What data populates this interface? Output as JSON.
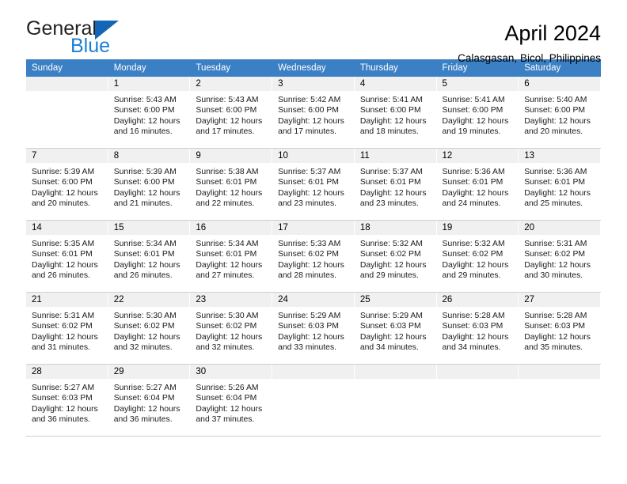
{
  "brand": {
    "name_part1": "General",
    "name_part2": "Blue",
    "triangle_icon": "blue-triangle-logo-mark",
    "colors": {
      "dark": "#231f20",
      "blue": "#1b7fd4",
      "triangle": "#1266b5"
    }
  },
  "header": {
    "title": "April 2024",
    "subtitle": "Calasgasan, Bicol, Philippines"
  },
  "calendar": {
    "accent_color": "#3b7fc4",
    "daynum_bg": "#f0f0f0",
    "weekday_headers": [
      "Sunday",
      "Monday",
      "Tuesday",
      "Wednesday",
      "Thursday",
      "Friday",
      "Saturday"
    ],
    "weeks": [
      [
        {
          "day": "",
          "sunrise": "",
          "sunset": "",
          "daylight_line1": "",
          "daylight_line2": ""
        },
        {
          "day": "1",
          "sunrise": "Sunrise: 5:43 AM",
          "sunset": "Sunset: 6:00 PM",
          "daylight_line1": "Daylight: 12 hours",
          "daylight_line2": "and 16 minutes."
        },
        {
          "day": "2",
          "sunrise": "Sunrise: 5:43 AM",
          "sunset": "Sunset: 6:00 PM",
          "daylight_line1": "Daylight: 12 hours",
          "daylight_line2": "and 17 minutes."
        },
        {
          "day": "3",
          "sunrise": "Sunrise: 5:42 AM",
          "sunset": "Sunset: 6:00 PM",
          "daylight_line1": "Daylight: 12 hours",
          "daylight_line2": "and 17 minutes."
        },
        {
          "day": "4",
          "sunrise": "Sunrise: 5:41 AM",
          "sunset": "Sunset: 6:00 PM",
          "daylight_line1": "Daylight: 12 hours",
          "daylight_line2": "and 18 minutes."
        },
        {
          "day": "5",
          "sunrise": "Sunrise: 5:41 AM",
          "sunset": "Sunset: 6:00 PM",
          "daylight_line1": "Daylight: 12 hours",
          "daylight_line2": "and 19 minutes."
        },
        {
          "day": "6",
          "sunrise": "Sunrise: 5:40 AM",
          "sunset": "Sunset: 6:00 PM",
          "daylight_line1": "Daylight: 12 hours",
          "daylight_line2": "and 20 minutes."
        }
      ],
      [
        {
          "day": "7",
          "sunrise": "Sunrise: 5:39 AM",
          "sunset": "Sunset: 6:00 PM",
          "daylight_line1": "Daylight: 12 hours",
          "daylight_line2": "and 20 minutes."
        },
        {
          "day": "8",
          "sunrise": "Sunrise: 5:39 AM",
          "sunset": "Sunset: 6:00 PM",
          "daylight_line1": "Daylight: 12 hours",
          "daylight_line2": "and 21 minutes."
        },
        {
          "day": "9",
          "sunrise": "Sunrise: 5:38 AM",
          "sunset": "Sunset: 6:01 PM",
          "daylight_line1": "Daylight: 12 hours",
          "daylight_line2": "and 22 minutes."
        },
        {
          "day": "10",
          "sunrise": "Sunrise: 5:37 AM",
          "sunset": "Sunset: 6:01 PM",
          "daylight_line1": "Daylight: 12 hours",
          "daylight_line2": "and 23 minutes."
        },
        {
          "day": "11",
          "sunrise": "Sunrise: 5:37 AM",
          "sunset": "Sunset: 6:01 PM",
          "daylight_line1": "Daylight: 12 hours",
          "daylight_line2": "and 23 minutes."
        },
        {
          "day": "12",
          "sunrise": "Sunrise: 5:36 AM",
          "sunset": "Sunset: 6:01 PM",
          "daylight_line1": "Daylight: 12 hours",
          "daylight_line2": "and 24 minutes."
        },
        {
          "day": "13",
          "sunrise": "Sunrise: 5:36 AM",
          "sunset": "Sunset: 6:01 PM",
          "daylight_line1": "Daylight: 12 hours",
          "daylight_line2": "and 25 minutes."
        }
      ],
      [
        {
          "day": "14",
          "sunrise": "Sunrise: 5:35 AM",
          "sunset": "Sunset: 6:01 PM",
          "daylight_line1": "Daylight: 12 hours",
          "daylight_line2": "and 26 minutes."
        },
        {
          "day": "15",
          "sunrise": "Sunrise: 5:34 AM",
          "sunset": "Sunset: 6:01 PM",
          "daylight_line1": "Daylight: 12 hours",
          "daylight_line2": "and 26 minutes."
        },
        {
          "day": "16",
          "sunrise": "Sunrise: 5:34 AM",
          "sunset": "Sunset: 6:01 PM",
          "daylight_line1": "Daylight: 12 hours",
          "daylight_line2": "and 27 minutes."
        },
        {
          "day": "17",
          "sunrise": "Sunrise: 5:33 AM",
          "sunset": "Sunset: 6:02 PM",
          "daylight_line1": "Daylight: 12 hours",
          "daylight_line2": "and 28 minutes."
        },
        {
          "day": "18",
          "sunrise": "Sunrise: 5:32 AM",
          "sunset": "Sunset: 6:02 PM",
          "daylight_line1": "Daylight: 12 hours",
          "daylight_line2": "and 29 minutes."
        },
        {
          "day": "19",
          "sunrise": "Sunrise: 5:32 AM",
          "sunset": "Sunset: 6:02 PM",
          "daylight_line1": "Daylight: 12 hours",
          "daylight_line2": "and 29 minutes."
        },
        {
          "day": "20",
          "sunrise": "Sunrise: 5:31 AM",
          "sunset": "Sunset: 6:02 PM",
          "daylight_line1": "Daylight: 12 hours",
          "daylight_line2": "and 30 minutes."
        }
      ],
      [
        {
          "day": "21",
          "sunrise": "Sunrise: 5:31 AM",
          "sunset": "Sunset: 6:02 PM",
          "daylight_line1": "Daylight: 12 hours",
          "daylight_line2": "and 31 minutes."
        },
        {
          "day": "22",
          "sunrise": "Sunrise: 5:30 AM",
          "sunset": "Sunset: 6:02 PM",
          "daylight_line1": "Daylight: 12 hours",
          "daylight_line2": "and 32 minutes."
        },
        {
          "day": "23",
          "sunrise": "Sunrise: 5:30 AM",
          "sunset": "Sunset: 6:02 PM",
          "daylight_line1": "Daylight: 12 hours",
          "daylight_line2": "and 32 minutes."
        },
        {
          "day": "24",
          "sunrise": "Sunrise: 5:29 AM",
          "sunset": "Sunset: 6:03 PM",
          "daylight_line1": "Daylight: 12 hours",
          "daylight_line2": "and 33 minutes."
        },
        {
          "day": "25",
          "sunrise": "Sunrise: 5:29 AM",
          "sunset": "Sunset: 6:03 PM",
          "daylight_line1": "Daylight: 12 hours",
          "daylight_line2": "and 34 minutes."
        },
        {
          "day": "26",
          "sunrise": "Sunrise: 5:28 AM",
          "sunset": "Sunset: 6:03 PM",
          "daylight_line1": "Daylight: 12 hours",
          "daylight_line2": "and 34 minutes."
        },
        {
          "day": "27",
          "sunrise": "Sunrise: 5:28 AM",
          "sunset": "Sunset: 6:03 PM",
          "daylight_line1": "Daylight: 12 hours",
          "daylight_line2": "and 35 minutes."
        }
      ],
      [
        {
          "day": "28",
          "sunrise": "Sunrise: 5:27 AM",
          "sunset": "Sunset: 6:03 PM",
          "daylight_line1": "Daylight: 12 hours",
          "daylight_line2": "and 36 minutes."
        },
        {
          "day": "29",
          "sunrise": "Sunrise: 5:27 AM",
          "sunset": "Sunset: 6:04 PM",
          "daylight_line1": "Daylight: 12 hours",
          "daylight_line2": "and 36 minutes."
        },
        {
          "day": "30",
          "sunrise": "Sunrise: 5:26 AM",
          "sunset": "Sunset: 6:04 PM",
          "daylight_line1": "Daylight: 12 hours",
          "daylight_line2": "and 37 minutes."
        },
        {
          "day": "",
          "sunrise": "",
          "sunset": "",
          "daylight_line1": "",
          "daylight_line2": ""
        },
        {
          "day": "",
          "sunrise": "",
          "sunset": "",
          "daylight_line1": "",
          "daylight_line2": ""
        },
        {
          "day": "",
          "sunrise": "",
          "sunset": "",
          "daylight_line1": "",
          "daylight_line2": ""
        },
        {
          "day": "",
          "sunrise": "",
          "sunset": "",
          "daylight_line1": "",
          "daylight_line2": ""
        }
      ]
    ]
  }
}
